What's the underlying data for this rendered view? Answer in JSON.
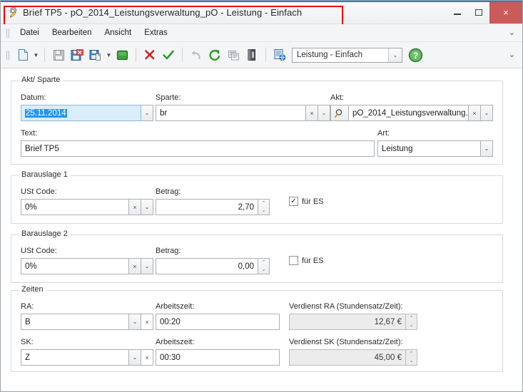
{
  "window": {
    "title": "Brief TP5 - pO_2014_Leistungsverwaltung_pO - Leistung - Einfach",
    "icon": "gear-pencil-icon",
    "highlight_color": "#ef0000",
    "buttons": {
      "minimize": "minimize-icon",
      "maximize": "maximize-icon",
      "close": "×"
    }
  },
  "menubar": {
    "items": [
      {
        "label": "Datei"
      },
      {
        "label": "Bearbeiten"
      },
      {
        "label": "Ansicht"
      },
      {
        "label": "Extras"
      }
    ],
    "overflow": "⌄"
  },
  "toolbar": {
    "overflow": "⌄",
    "buttons": [
      {
        "name": "new-document-icon",
        "tooltip": "Neu"
      },
      {
        "name": "new-document-dropdown-icon",
        "tooltip": "Neu Optionen"
      },
      {
        "name": "save-icon",
        "tooltip": "Speichern"
      },
      {
        "name": "save-close-icon",
        "tooltip": "Speichern und schließen"
      },
      {
        "name": "save-as-icon",
        "tooltip": "Speichern unter"
      },
      {
        "name": "save-as-dropdown-icon",
        "tooltip": "Speichern unter Optionen"
      },
      {
        "name": "green-square-icon",
        "tooltip": "Status"
      },
      {
        "name": "delete-red-x-icon",
        "tooltip": "Löschen"
      },
      {
        "name": "confirm-green-check-icon",
        "tooltip": "Bestätigen"
      },
      {
        "name": "undo-icon",
        "tooltip": "Rückgängig"
      },
      {
        "name": "redo-icon",
        "tooltip": "Wiederholen"
      },
      {
        "name": "copy-records-icon",
        "tooltip": "Kopieren"
      },
      {
        "name": "binder-icon",
        "tooltip": "Akt"
      },
      {
        "name": "report-web-icon",
        "tooltip": "Bericht"
      },
      {
        "name": "help-icon",
        "tooltip": "Hilfe"
      }
    ],
    "view_combo": {
      "value": "Leistung - Einfach",
      "arrow": "⌄"
    }
  },
  "groups": {
    "akt_sparte": {
      "legend": "Akt/ Sparte",
      "fields": {
        "datum": {
          "label": "Datum:",
          "value": "25.11.2014",
          "selected": true,
          "arrow": "⌄"
        },
        "sparte": {
          "label": "Sparte:",
          "value": "br",
          "clear": "×",
          "arrow": "⌄"
        },
        "akt": {
          "label": "Akt:",
          "value": "pO_2014_Leistungsverwaltung...",
          "search_icon": "magnifier-icon",
          "clear": "×",
          "arrow": "⌄"
        },
        "text": {
          "label": "Text:",
          "value": "Brief TP5"
        },
        "art": {
          "label": "Art:",
          "value": "Leistung",
          "arrow": "⌄"
        }
      }
    },
    "barauslage1": {
      "legend": "Barauslage 1",
      "fields": {
        "ust_code": {
          "label": "USt Code:",
          "value": "0%",
          "clear": "×",
          "arrow": "⌄"
        },
        "betrag": {
          "label": "Betrag:",
          "value": "2,70",
          "spin_up": "⌃",
          "spin_down": "⌄"
        },
        "fuer_es": {
          "label": "für ES",
          "checked": true,
          "mark": "✓"
        }
      }
    },
    "barauslage2": {
      "legend": "Barauslage 2",
      "fields": {
        "ust_code": {
          "label": "USt Code:",
          "value": "0%",
          "clear": "×",
          "arrow": "⌄"
        },
        "betrag": {
          "label": "Betrag:",
          "value": "0,00",
          "spin_up": "⌃",
          "spin_down": "⌄"
        },
        "fuer_es": {
          "label": "für ES",
          "checked": false,
          "mark": ""
        }
      }
    },
    "zeiten": {
      "legend": "Zeiten",
      "fields": {
        "ra": {
          "label": "RA:",
          "value": "B",
          "arrow": "⌄",
          "clear": "×"
        },
        "ra_arbeitszeit": {
          "label": "Arbeitszeit:",
          "value": "00:20"
        },
        "verdienst_ra": {
          "label": "Verdienst RA (Stundensatz/Zeit):",
          "value": "12,67 €",
          "spin_up": "⌃",
          "spin_down": "⌄"
        },
        "sk": {
          "label": "SK:",
          "value": "Z",
          "arrow": "⌄",
          "clear": "×"
        },
        "sk_arbeitszeit": {
          "label": "Arbeitszeit:",
          "value": "00:30"
        },
        "verdienst_sk": {
          "label": "Verdienst SK (Stundensatz/Zeit):",
          "value": "45,00 €",
          "spin_up": "⌃",
          "spin_down": "⌄"
        }
      }
    }
  }
}
